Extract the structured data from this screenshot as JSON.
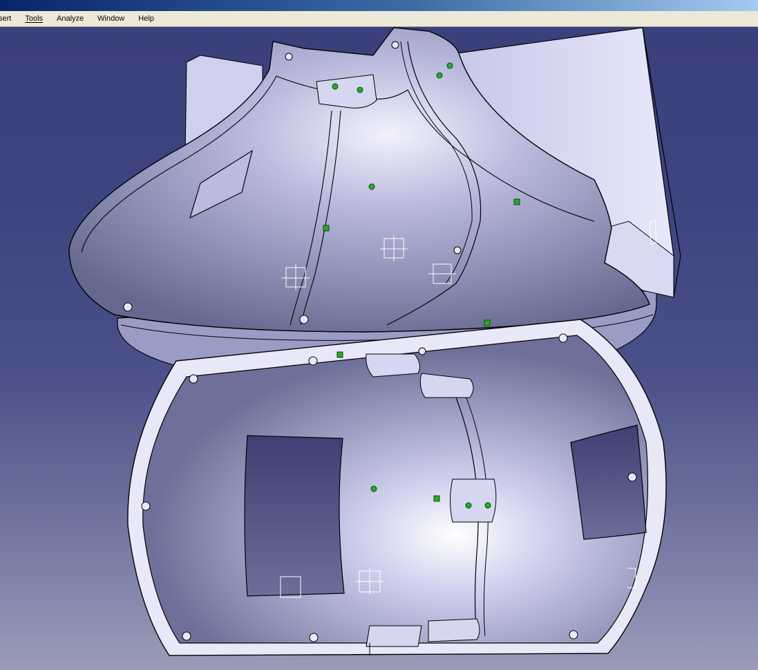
{
  "window": {
    "title": ""
  },
  "menu": {
    "items": [
      {
        "label": "sert",
        "accel": ""
      },
      {
        "label": "Tools",
        "accel": "T"
      },
      {
        "label": "Analyze",
        "accel": "A"
      },
      {
        "label": "Window",
        "accel": "W"
      },
      {
        "label": "Help",
        "accel": "H"
      }
    ]
  },
  "viewport": {
    "description_icon": "3d-part-icon",
    "colors": {
      "part_light": "#e4e4f6",
      "part_mid": "#a9abd0",
      "part_dark": "#6a6c98",
      "edge": "#000000",
      "marker": "#2aa82a"
    }
  }
}
